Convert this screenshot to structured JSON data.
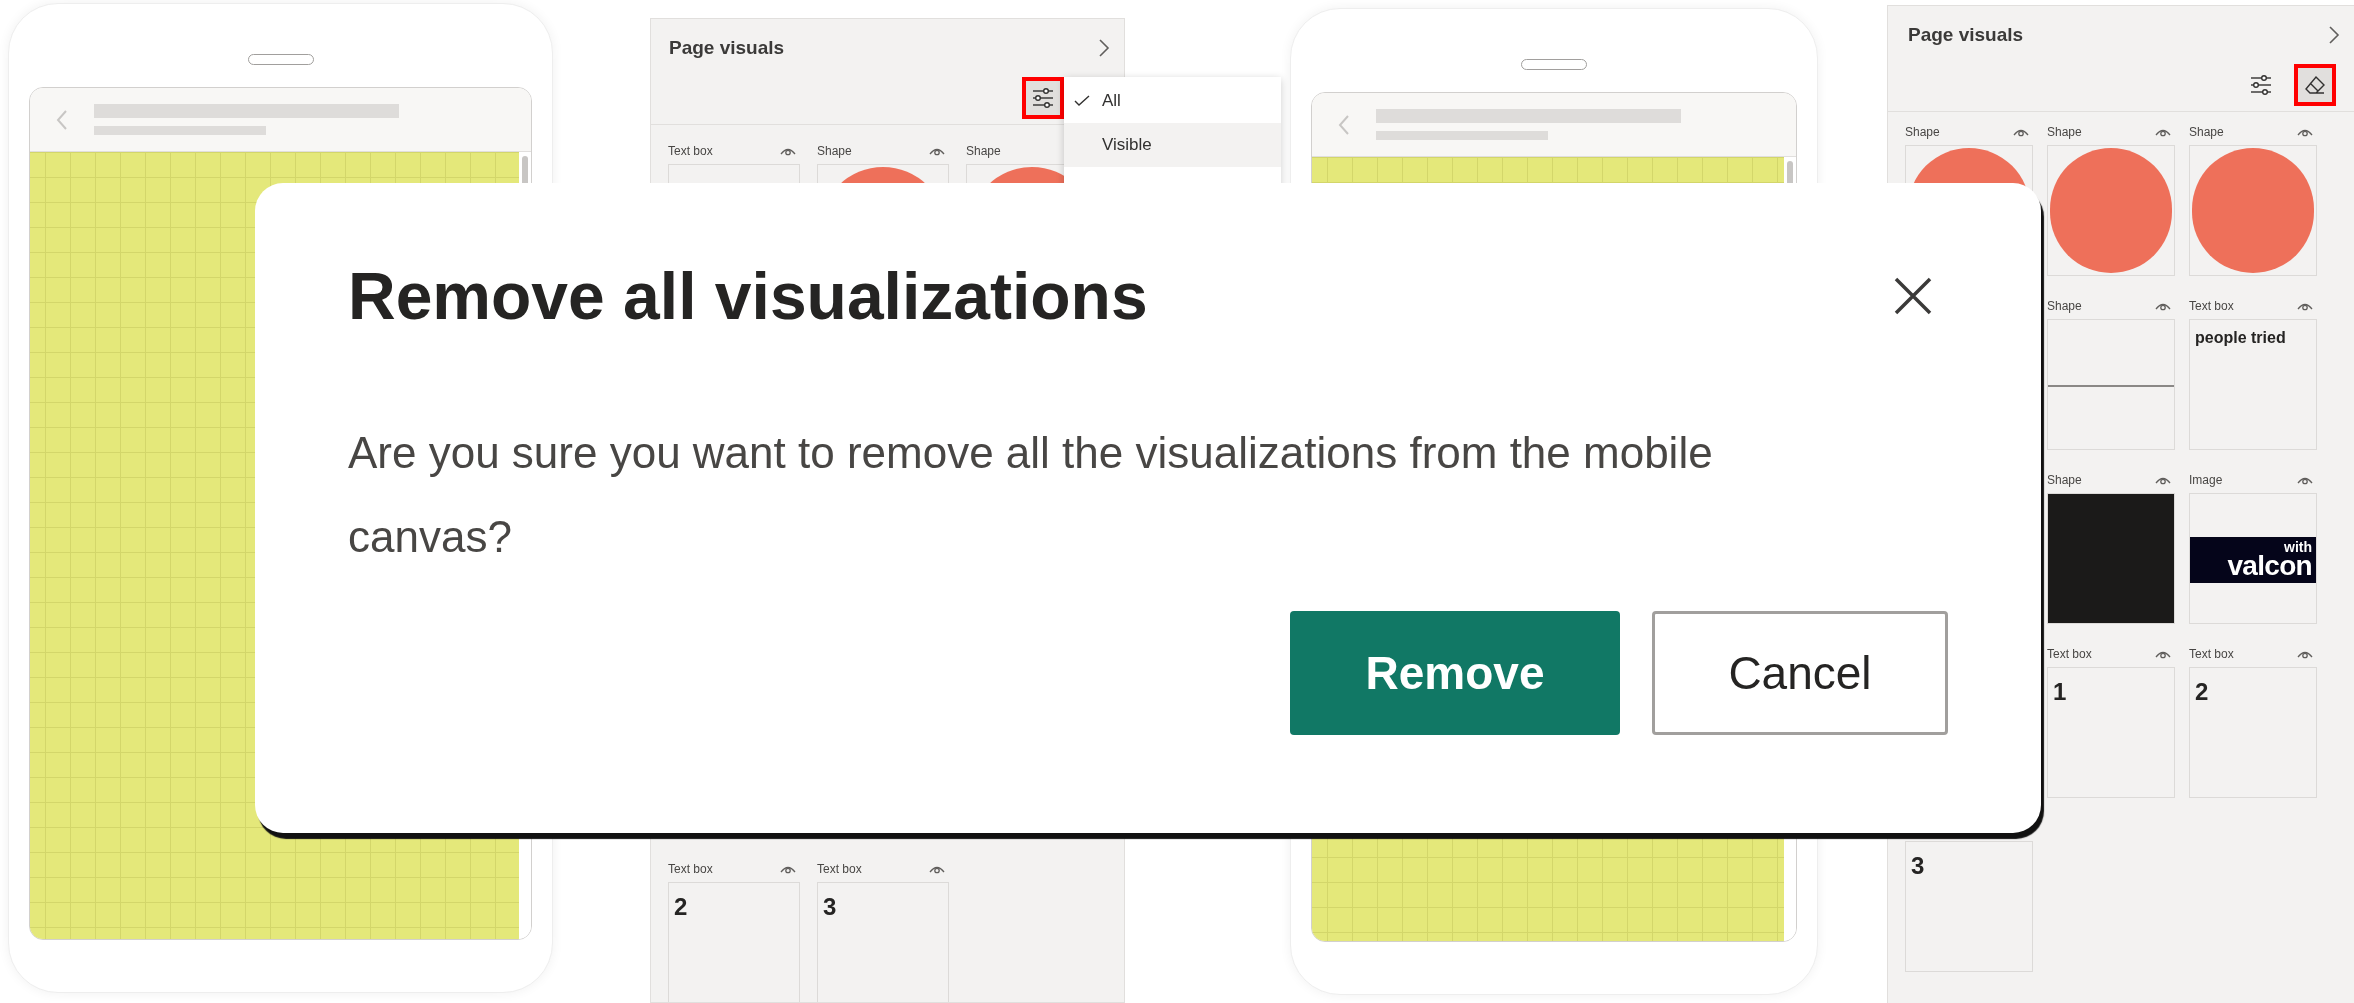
{
  "panels": [
    {
      "title": "Page visuals",
      "toolbar": [
        {
          "kind": "filter",
          "outlined": true
        }
      ],
      "filter_menu": [
        {
          "label": "All",
          "checked": true,
          "highlighted": false
        },
        {
          "label": "Visible",
          "checked": false,
          "highlighted": true
        }
      ],
      "top_tiles": [
        {
          "label": "Text box",
          "kind": "covered"
        },
        {
          "label": "Shape",
          "kind": "circle"
        },
        {
          "label": "Shape",
          "kind": "circle"
        }
      ],
      "bottom_tiles": [
        {
          "label": "Text box",
          "kind": "text",
          "text": "2"
        },
        {
          "label": "Text box",
          "kind": "text",
          "text": "3"
        }
      ]
    },
    {
      "title": "Page visuals",
      "toolbar": [
        {
          "kind": "filter",
          "outlined": false
        },
        {
          "kind": "eraser",
          "outlined": true
        }
      ],
      "tiles": [
        {
          "label": "Shape",
          "kind": "circle"
        },
        {
          "label": "Shape",
          "kind": "circle"
        },
        {
          "label": "Shape",
          "kind": "circle"
        },
        {
          "kind": "covered"
        },
        {
          "label": "Shape",
          "kind": "line"
        },
        {
          "label": "Text box",
          "kind": "text",
          "text": "people tried"
        },
        {
          "kind": "covered"
        },
        {
          "label": "Shape",
          "kind": "rect"
        },
        {
          "label": "Image",
          "kind": "logo",
          "logo_small": "with",
          "logo_large": "valcon"
        },
        {
          "kind": "covered"
        },
        {
          "label": "Text box",
          "kind": "text",
          "text": "1"
        },
        {
          "label": "Text box",
          "kind": "text",
          "text": "2"
        },
        {
          "kind": "text",
          "text": "3"
        }
      ]
    }
  ],
  "dialog": {
    "title": "Remove all visualizations",
    "message": "Are you sure you want to remove all the visualizations from the mobile canvas?",
    "buttons": [
      {
        "label": "Remove",
        "kind": "primary"
      },
      {
        "label": "Cancel",
        "kind": "secondary"
      }
    ]
  }
}
